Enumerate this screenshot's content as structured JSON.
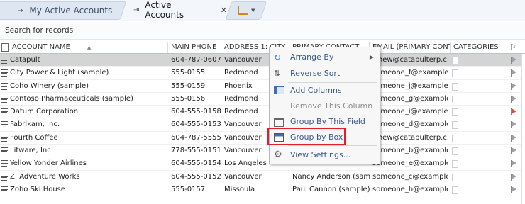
{
  "tabs": [
    {
      "label": "My Active Accounts",
      "active": false
    },
    {
      "label": "Active Accounts",
      "active": true,
      "close": "✕"
    }
  ],
  "search": {
    "placeholder": "Search for records"
  },
  "columns": [
    "ACCOUNT NAME",
    "MAIN PHONE",
    "ADDRESS 1: CITY",
    "PRIMARY CONTACT",
    "EMAIL (PRIMARY CONT...",
    "CATEGORIES"
  ],
  "rows": [
    {
      "name": "Catapult",
      "phone": "604-787-0607",
      "city": "Vancouver",
      "contact": "",
      "email": "tthew@catapulterp.c...",
      "selected": true,
      "flag": "gray"
    },
    {
      "name": "City Power & Light (sample)",
      "phone": "555-0155",
      "city": "Redmond",
      "contact": "",
      "email": "someone_f@example.c...",
      "selected": false,
      "flag": "gray"
    },
    {
      "name": "Coho Winery (sample)",
      "phone": "555-0159",
      "city": "Phoenix",
      "contact": "",
      "email": "someone_j@example.c...",
      "selected": false,
      "flag": "gray"
    },
    {
      "name": "Contoso Pharmaceuticals (sample)",
      "phone": "555-0156",
      "city": "Redmond",
      "contact": "",
      "email": "someone_g@example.c...",
      "selected": false,
      "flag": "gray"
    },
    {
      "name": "Datum Corporation",
      "phone": "604-555-0158",
      "city": "Redmond",
      "contact": "",
      "email": "someone_i@example.c...",
      "selected": false,
      "flag": "red"
    },
    {
      "name": "Fabrikam, Inc.",
      "phone": "604-555-0153",
      "city": "Vancouver",
      "contact": "",
      "email": "someone_d@example.c...",
      "selected": false,
      "flag": "gray"
    },
    {
      "name": "Fourth Coffee",
      "phone": "604-787-5555",
      "city": "Vancouver",
      "contact": "",
      "email": "tthew@catapulterp.c...",
      "selected": false,
      "flag": "gray"
    },
    {
      "name": "Litware, Inc.",
      "phone": "778-555-0151",
      "city": "Vancouver",
      "contact": "",
      "email": "someone_b@example.c...",
      "selected": false,
      "flag": "gray"
    },
    {
      "name": "Yellow Yonder Airlines",
      "phone": "604-555-0154",
      "city": "Los Angeles",
      "contact": "",
      "email": "someone_e@example.c...",
      "selected": false,
      "flag": "gray"
    },
    {
      "name": "Z. Adventure Works",
      "phone": "604-555-0152",
      "city": "Vancouver",
      "contact": "Nancy Anderson (samp...",
      "email": "someone_c@example.c...",
      "selected": false,
      "flag": "gray"
    },
    {
      "name": "Zoho Ski House",
      "phone": "555-0157",
      "city": "Missoula",
      "contact": "Paul Cannon (sample)",
      "email": "someone_h@example.c...",
      "selected": false,
      "flag": "gray"
    }
  ],
  "menu": [
    {
      "label": "Arrange By",
      "icon": "arrow-icon",
      "submenu": true,
      "enabled": true
    },
    {
      "label": "Reverse Sort",
      "icon": "sort-icon",
      "enabled": true
    },
    {
      "label": "Add Columns",
      "icon": "columns-icon",
      "enabled": true
    },
    {
      "label": "Remove This Column",
      "icon": "",
      "enabled": false
    },
    {
      "label": "Group By This Field",
      "icon": "group-icon",
      "enabled": true
    },
    {
      "label": "Group by Box",
      "icon": "group-box-icon",
      "enabled": true,
      "highlighted": true
    },
    {
      "label": "View Settings...",
      "icon": "gear-icon",
      "enabled": true
    }
  ],
  "colors": {
    "highlight": "#e21e26",
    "menu_text": "#3b5a8c",
    "flag_red": "#e04a3a"
  }
}
